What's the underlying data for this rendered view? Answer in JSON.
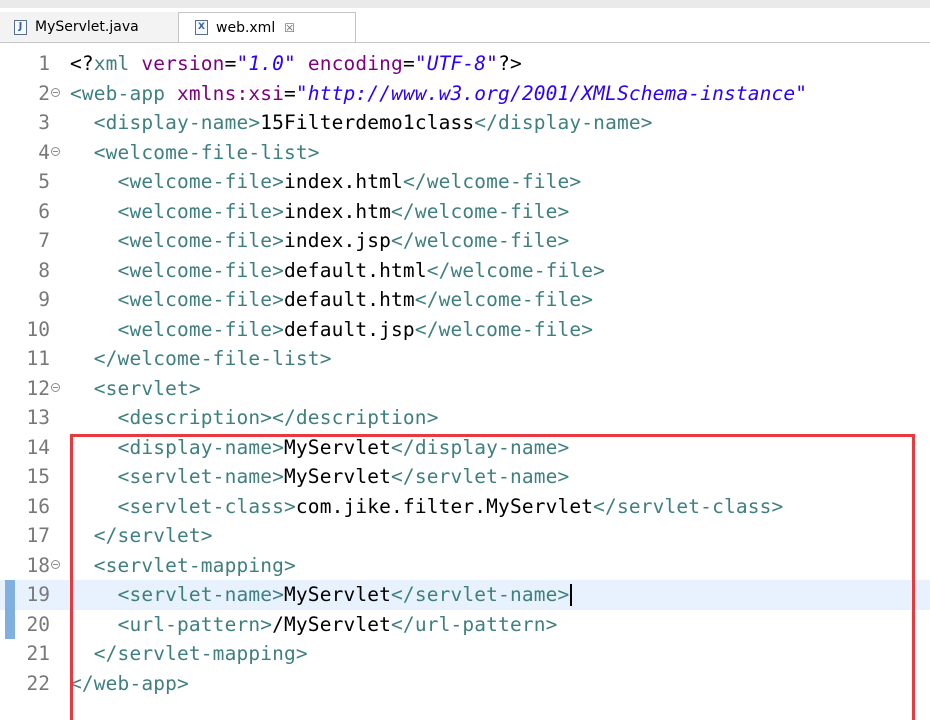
{
  "tabs": [
    {
      "label": "MyServlet.java",
      "icon": "java-file-icon",
      "active": false
    },
    {
      "label": "web.xml",
      "icon": "xml-file-icon",
      "active": true,
      "close_glyph": "☒"
    }
  ],
  "colors": {
    "tag": "#3f7f7f",
    "attribute": "#7f007f",
    "value": "#2a00ff",
    "text": "#000000",
    "highlight_box": "#e8393e",
    "current_line": "#e8f2fe"
  },
  "editor": {
    "current_line": 19,
    "lines": [
      {
        "n": "1",
        "fold": false,
        "tokens": [
          [
            "p",
            "<?"
          ],
          [
            "t",
            "xml"
          ],
          [
            "p",
            " "
          ],
          [
            "a",
            "version"
          ],
          [
            "p",
            "="
          ],
          [
            "v",
            "\"1.0\""
          ],
          [
            "p",
            " "
          ],
          [
            "a",
            "encoding"
          ],
          [
            "p",
            "="
          ],
          [
            "v",
            "\"UTF-8\""
          ],
          [
            "p",
            "?>"
          ]
        ]
      },
      {
        "n": "2",
        "fold": true,
        "tokens": [
          [
            "t",
            "<web-app"
          ],
          [
            "p",
            " "
          ],
          [
            "a",
            "xmlns:xsi"
          ],
          [
            "p",
            "="
          ],
          [
            "v",
            "\"http://www.w3.org/2001/XMLSchema-instance\""
          ]
        ]
      },
      {
        "n": "3",
        "fold": false,
        "tokens": [
          [
            "p",
            "  "
          ],
          [
            "t",
            "<display-name>"
          ],
          [
            "x",
            "15Filterdemo1class"
          ],
          [
            "t",
            "</display-name>"
          ]
        ]
      },
      {
        "n": "4",
        "fold": true,
        "tokens": [
          [
            "p",
            "  "
          ],
          [
            "t",
            "<welcome-file-list>"
          ]
        ]
      },
      {
        "n": "5",
        "fold": false,
        "tokens": [
          [
            "p",
            "    "
          ],
          [
            "t",
            "<welcome-file>"
          ],
          [
            "x",
            "index.html"
          ],
          [
            "t",
            "</welcome-file>"
          ]
        ]
      },
      {
        "n": "6",
        "fold": false,
        "tokens": [
          [
            "p",
            "    "
          ],
          [
            "t",
            "<welcome-file>"
          ],
          [
            "x",
            "index.htm"
          ],
          [
            "t",
            "</welcome-file>"
          ]
        ]
      },
      {
        "n": "7",
        "fold": false,
        "tokens": [
          [
            "p",
            "    "
          ],
          [
            "t",
            "<welcome-file>"
          ],
          [
            "x",
            "index.jsp"
          ],
          [
            "t",
            "</welcome-file>"
          ]
        ]
      },
      {
        "n": "8",
        "fold": false,
        "tokens": [
          [
            "p",
            "    "
          ],
          [
            "t",
            "<welcome-file>"
          ],
          [
            "x",
            "default.html"
          ],
          [
            "t",
            "</welcome-file>"
          ]
        ]
      },
      {
        "n": "9",
        "fold": false,
        "tokens": [
          [
            "p",
            "    "
          ],
          [
            "t",
            "<welcome-file>"
          ],
          [
            "x",
            "default.htm"
          ],
          [
            "t",
            "</welcome-file>"
          ]
        ]
      },
      {
        "n": "10",
        "fold": false,
        "tokens": [
          [
            "p",
            "    "
          ],
          [
            "t",
            "<welcome-file>"
          ],
          [
            "x",
            "default.jsp"
          ],
          [
            "t",
            "</welcome-file>"
          ]
        ]
      },
      {
        "n": "11",
        "fold": false,
        "tokens": [
          [
            "p",
            "  "
          ],
          [
            "t",
            "</welcome-file-list>"
          ]
        ]
      },
      {
        "n": "12",
        "fold": true,
        "tokens": [
          [
            "p",
            "  "
          ],
          [
            "t",
            "<servlet>"
          ]
        ]
      },
      {
        "n": "13",
        "fold": false,
        "tokens": [
          [
            "p",
            "    "
          ],
          [
            "t",
            "<description></description>"
          ]
        ]
      },
      {
        "n": "14",
        "fold": false,
        "tokens": [
          [
            "p",
            "    "
          ],
          [
            "t",
            "<display-name>"
          ],
          [
            "x",
            "MyServlet"
          ],
          [
            "t",
            "</display-name>"
          ]
        ]
      },
      {
        "n": "15",
        "fold": false,
        "tokens": [
          [
            "p",
            "    "
          ],
          [
            "t",
            "<servlet-name>"
          ],
          [
            "x",
            "MyServlet"
          ],
          [
            "t",
            "</servlet-name>"
          ]
        ]
      },
      {
        "n": "16",
        "fold": false,
        "tokens": [
          [
            "p",
            "    "
          ],
          [
            "t",
            "<servlet-class>"
          ],
          [
            "x",
            "com.jike.filter.MyServlet"
          ],
          [
            "t",
            "</servlet-class>"
          ]
        ]
      },
      {
        "n": "17",
        "fold": false,
        "tokens": [
          [
            "p",
            "  "
          ],
          [
            "t",
            "</servlet>"
          ]
        ]
      },
      {
        "n": "18",
        "fold": true,
        "tokens": [
          [
            "p",
            "  "
          ],
          [
            "t",
            "<servlet-mapping>"
          ]
        ]
      },
      {
        "n": "19",
        "fold": false,
        "tokens": [
          [
            "p",
            "    "
          ],
          [
            "t",
            "<servlet-name>"
          ],
          [
            "x",
            "MyServlet"
          ],
          [
            "t",
            "</servlet-name>"
          ]
        ]
      },
      {
        "n": "20",
        "fold": false,
        "tokens": [
          [
            "p",
            "    "
          ],
          [
            "t",
            "<url-pattern>"
          ],
          [
            "x",
            "/MyServlet"
          ],
          [
            "t",
            "</url-pattern>"
          ]
        ]
      },
      {
        "n": "21",
        "fold": false,
        "tokens": [
          [
            "p",
            "  "
          ],
          [
            "t",
            "</servlet-mapping>"
          ]
        ]
      },
      {
        "n": "22",
        "fold": false,
        "tokens": [
          [
            "t",
            "</web-app>"
          ]
        ]
      }
    ]
  }
}
